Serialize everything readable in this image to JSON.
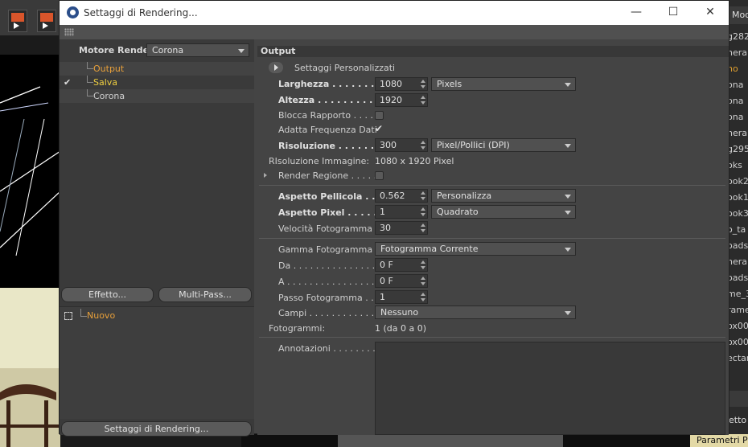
{
  "background": {
    "objects": [
      "g282",
      "nera.",
      "no",
      "ona",
      "ona",
      "ona",
      "nera",
      "g295",
      "oks",
      "ook2",
      "ook1",
      "ook3",
      "o_ta",
      "oads",
      "nera.",
      "oads",
      "me_3",
      "rame",
      "ox00",
      "ox00",
      "ectar"
    ],
    "selected_object_index": 2,
    "header_text": "Mod",
    "bottom_text": "etto",
    "params_tab": "Parametri Pro"
  },
  "dialog": {
    "title": "Settaggi di Rendering...",
    "window_controls": {
      "minimize": "—",
      "maximize": "☐",
      "close": "✕"
    },
    "engine_label": "Motore Render",
    "engine_value": "Corona",
    "tree": [
      {
        "label": "Output",
        "checked": false,
        "active": true
      },
      {
        "label": "Salva",
        "checked": true,
        "active": false
      },
      {
        "label": "Corona",
        "checked": false,
        "active": false
      }
    ],
    "effect_button": "Effetto...",
    "multipass_button": "Multi-Pass...",
    "new_item": "Nuovo",
    "render_settings_button": "Settaggi di Rendering...",
    "output": {
      "section_title": "Output",
      "custom_settings": "Settaggi Personalizzati",
      "width_label": "Larghezza",
      "width_value": "1080",
      "width_unit": "Pixels",
      "height_label": "Altezza",
      "height_value": "1920",
      "lock_ratio_label": "Blocca Rapporto",
      "adapt_frame_label": "Adatta Frequenza Dati",
      "resolution_label": "Risoluzione",
      "resolution_value": "300",
      "resolution_unit": "Pixel/Pollici (DPI)",
      "image_resolution_label": "RIsoluzione Immagine:",
      "image_resolution_value": "1080 x 1920 Pixel",
      "render_region_label": "Render Regione",
      "film_aspect_label": "Aspetto Pellicola",
      "film_aspect_value": "0.562",
      "film_aspect_mode": "Personalizza",
      "pixel_aspect_label": "Aspetto Pixel",
      "pixel_aspect_value": "1",
      "pixel_aspect_mode": "Quadrato",
      "fps_label": "Velocità Fotogramma",
      "fps_value": "30",
      "frame_range_label": "Gamma Fotogramma",
      "frame_range_value": "Fotogramma Corrente",
      "from_label": "Da",
      "from_value": "0 F",
      "to_label": "A",
      "to_value": "0 F",
      "frame_step_label": "Passo Fotogramma",
      "frame_step_value": "1",
      "fields_label": "Campi",
      "fields_value": "Nessuno",
      "frames_label": "Fotogrammi:",
      "frames_value": "1 (da 0 a 0)",
      "notes_label": "Annotazioni"
    }
  }
}
